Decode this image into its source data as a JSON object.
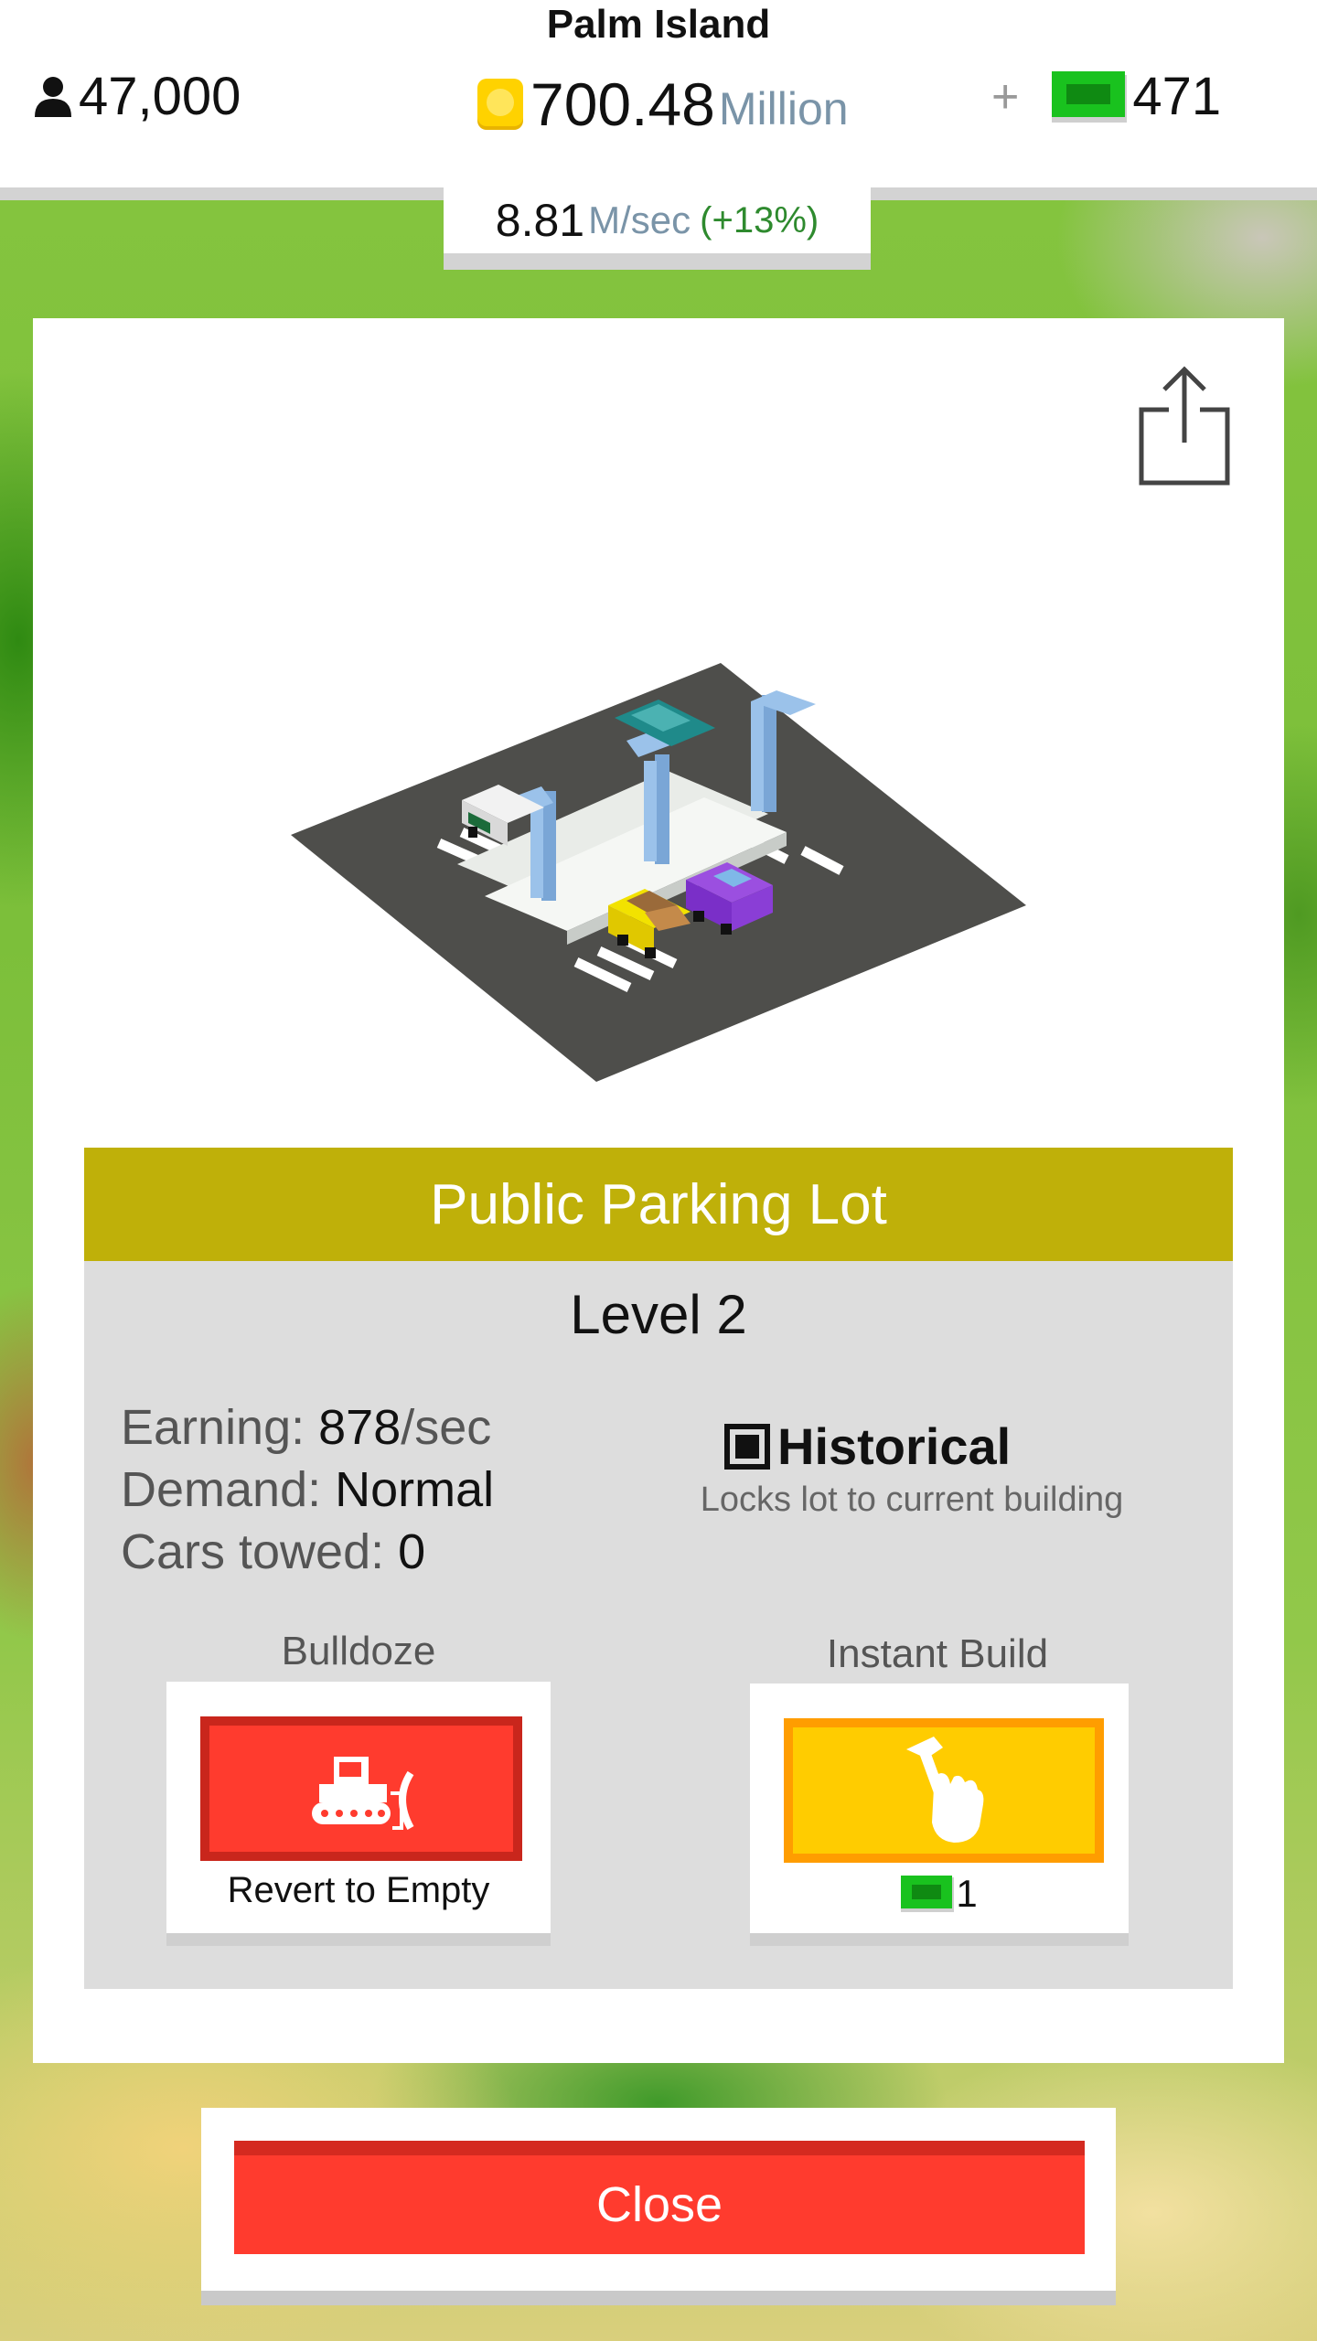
{
  "header": {
    "island_name": "Palm Island",
    "population": "47,000",
    "coins": "700.48",
    "coins_unit": "Million",
    "plus": "+",
    "cash": "471",
    "rate_value": "8.81",
    "rate_unit": "M/sec",
    "rate_change": "(+13%)"
  },
  "building": {
    "name": "Public Parking Lot",
    "level": "Level 2",
    "earning_label": "Earning: ",
    "earning_value": "878",
    "earning_unit": "/sec",
    "demand_label": "Demand: ",
    "demand_value": "Normal",
    "cars_towed_label": "Cars towed: ",
    "cars_towed_value": "0",
    "historical_label": "Historical",
    "historical_checked": true,
    "historical_desc": "Locks lot to current building"
  },
  "actions": {
    "bulldoze_label": "Bulldoze",
    "bulldoze_button_text": "Revert to Empty",
    "instant_build_label": "Instant Build",
    "instant_build_cost": "1"
  },
  "close_label": "Close",
  "icons": {
    "population": "person-icon",
    "coins": "coin-icon",
    "cash": "cash-icon",
    "share": "share-icon",
    "bulldoze": "bulldozer-icon",
    "instant_build": "hammer-hand-icon"
  },
  "colors": {
    "title_bar": "#bfb009",
    "bulldoze_button": "#ff3b2e",
    "instant_build_button": "#ffcc00",
    "close_button": "#ff3b2e",
    "cash_green": "#19c21e"
  }
}
